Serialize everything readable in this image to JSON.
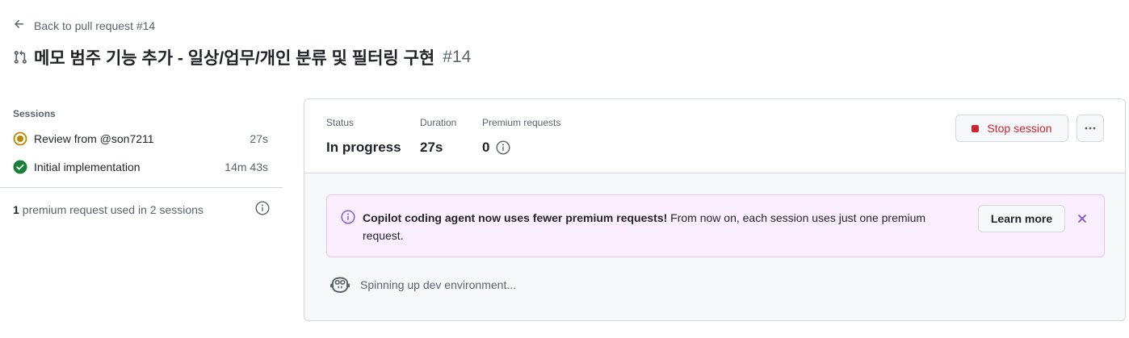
{
  "nav": {
    "back_label": "Back to pull request #14"
  },
  "header": {
    "title": "메모 범주 기능 추가 - 일상/업무/개인 분류 및 필터링 구현",
    "pr_number": "#14"
  },
  "sidebar": {
    "sessions_heading": "Sessions",
    "sessions": [
      {
        "label": "Review from @son7211",
        "duration": "27s",
        "status": "in-progress"
      },
      {
        "label": "Initial implementation",
        "duration": "14m 43s",
        "status": "completed"
      }
    ],
    "premium_count": "1",
    "premium_text": "premium request used in 2 sessions"
  },
  "panel": {
    "stats": [
      {
        "label": "Status",
        "value": "In progress"
      },
      {
        "label": "Duration",
        "value": "27s"
      },
      {
        "label": "Premium requests",
        "value": "0"
      }
    ],
    "stop_label": "Stop session",
    "banner": {
      "bold": "Copilot coding agent now uses fewer premium requests!",
      "text": " From now on, each session uses just one premium request.",
      "learn_label": "Learn more"
    },
    "spinning_text": "Spinning up dev environment..."
  },
  "colors": {
    "accent_red": "#d1242f",
    "success_green": "#1a7f37",
    "in_progress_yellow": "#bf8700",
    "banner_purple": "#8250df",
    "banner_bg": "#fbefff"
  },
  "icons": {
    "back": "arrow-left-icon",
    "pr": "git-pull-request-icon",
    "session_in_progress": "dot-fill-icon",
    "session_done": "check-circle-icon",
    "info": "info-icon",
    "stop": "square-stop-icon",
    "more": "kebab-horizontal-icon",
    "close": "x-icon",
    "copilot": "copilot-icon"
  }
}
